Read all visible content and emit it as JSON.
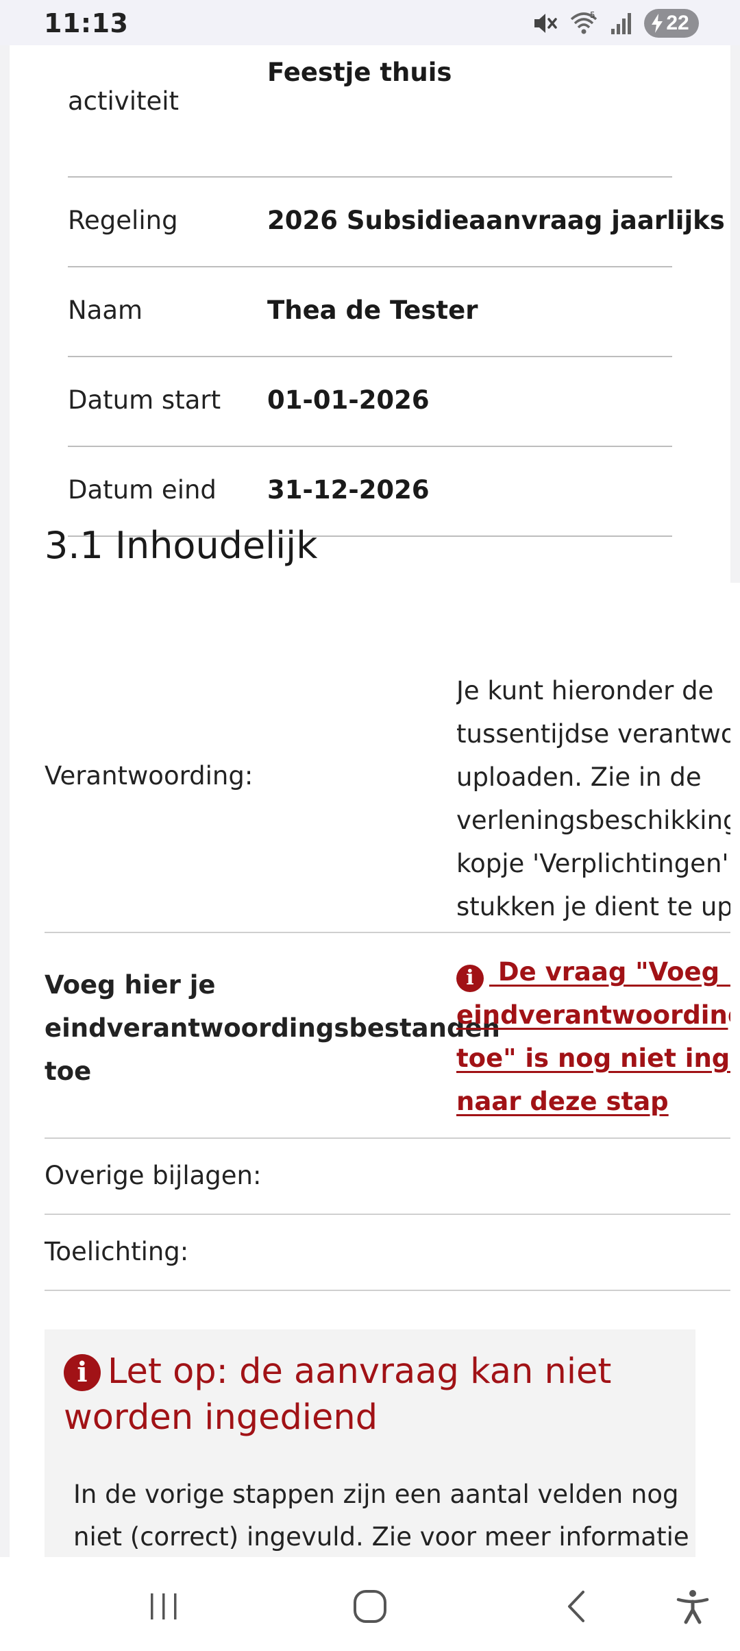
{
  "status_bar": {
    "time": "11:13",
    "battery": "22",
    "icons": [
      "mute-icon",
      "wifi-icon",
      "signal-icon",
      "battery-icon"
    ]
  },
  "details": [
    {
      "label": "activiteit",
      "value": "Feestje thuis"
    },
    {
      "label": "Regeling",
      "value": "2026 Subsidieaanvraag jaarlijks"
    },
    {
      "label": "Naam",
      "value": "Thea de Tester"
    },
    {
      "label": "Datum start",
      "value": "01-01-2026"
    },
    {
      "label": "Datum eind",
      "value": "31-12-2026"
    }
  ],
  "section": {
    "title": "3.1 Inhoudelijk"
  },
  "form": {
    "verantwoording": {
      "label": "Verantwoording:",
      "lines": [
        "Je kunt hieronder de",
        "tussentijdse verantwoording",
        "uploaden. Zie in de",
        "verleningsbeschikking onder",
        "kopje 'Verplichtingen' welke",
        "stukken je dient te uploaden."
      ]
    },
    "upload": {
      "label_lines": [
        "Voeg hier je",
        "eindverantwoordingsbestanden",
        "toe"
      ],
      "error_lines": [
        " De vraag \"Voeg hier je",
        "eindverantwoordingsbestanden",
        "toe\" is nog niet ingevuld. Ga",
        "naar deze stap"
      ]
    },
    "overige": {
      "label": "Overige bijlagen:"
    },
    "toelichting": {
      "label": "Toelichting:"
    }
  },
  "alert": {
    "title": "Let op: de aanvraag kan niet worden ingediend",
    "text": "In de vorige stappen zijn een aantal velden nog niet (correct) ingevuld. Zie voor meer informatie"
  },
  "colors": {
    "error": "#a11216",
    "divider": "#bdbdbd",
    "alert_bg": "#f3f3f3"
  }
}
